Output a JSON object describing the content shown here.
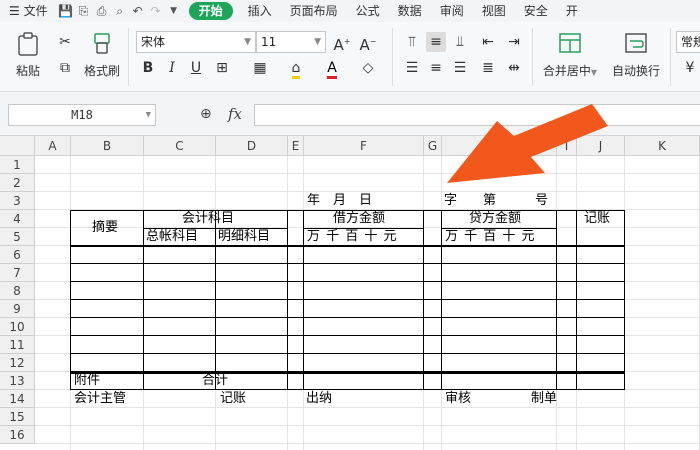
{
  "menubar": {
    "file": "文件",
    "tabs": [
      {
        "label": "开始",
        "active": true
      },
      {
        "label": "插入"
      },
      {
        "label": "页面布局"
      },
      {
        "label": "公式"
      },
      {
        "label": "数据"
      },
      {
        "label": "审阅"
      },
      {
        "label": "视图"
      },
      {
        "label": "安全"
      }
    ],
    "overflow": "开"
  },
  "ribbon": {
    "paste": "粘贴",
    "format_painter": "格式刷",
    "font_name": "宋体",
    "font_size": "11",
    "merge_center": "合并居中",
    "wrap_text": "自动换行",
    "number_format": "常规"
  },
  "formula_bar": {
    "cell_ref": "M18",
    "fx": "fx",
    "value": ""
  },
  "columns": [
    "A",
    "B",
    "C",
    "D",
    "E",
    "F",
    "G",
    "H",
    "I",
    "J",
    "K"
  ],
  "rows": [
    "1",
    "2",
    "3",
    "4",
    "5",
    "6",
    "7",
    "8",
    "9",
    "10",
    "11",
    "12",
    "13",
    "14",
    "15",
    "16"
  ],
  "voucher": {
    "date_line": "年　月　日",
    "serial_line": "字　　第　　　号",
    "summary": "摘要",
    "account_subject": "会计科目",
    "general_account": "总帐科目",
    "detail_account": "明细科目",
    "debit": "借方金额",
    "credit": "贷方金额",
    "posting": "记账",
    "units_debit": "万 千 百 十 元",
    "units_credit": "万 千 百 十 元",
    "attachments": "附件",
    "total": "合计",
    "chief_accountant": "会计主管",
    "bookkeeper": "记账",
    "cashier": "出纳",
    "reviewer": "审核",
    "preparer": "制单"
  },
  "colors": {
    "accent": "#1da65a",
    "arrow": "#f2581c"
  }
}
